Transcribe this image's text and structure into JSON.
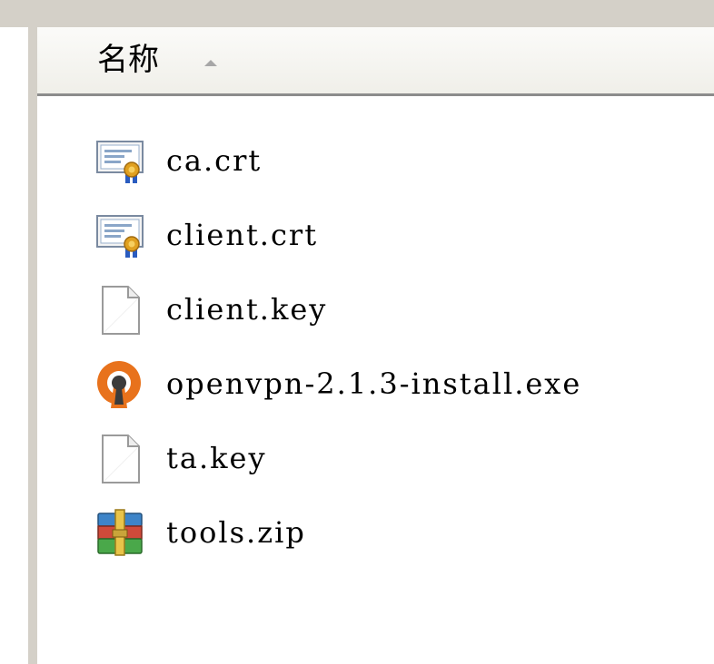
{
  "column_header": {
    "title": "名称",
    "sort": "ascending"
  },
  "files": [
    {
      "name": "ca.crt",
      "icon": "certificate-icon"
    },
    {
      "name": "client.crt",
      "icon": "certificate-icon"
    },
    {
      "name": "client.key",
      "icon": "blank-file-icon"
    },
    {
      "name": "openvpn-2.1.3-install.exe",
      "icon": "openvpn-icon"
    },
    {
      "name": "ta.key",
      "icon": "blank-file-icon"
    },
    {
      "name": "tools.zip",
      "icon": "winrar-archive-icon"
    }
  ],
  "colors": {
    "chrome": "#d4d0c8",
    "openvpn_orange": "#e8721c"
  }
}
